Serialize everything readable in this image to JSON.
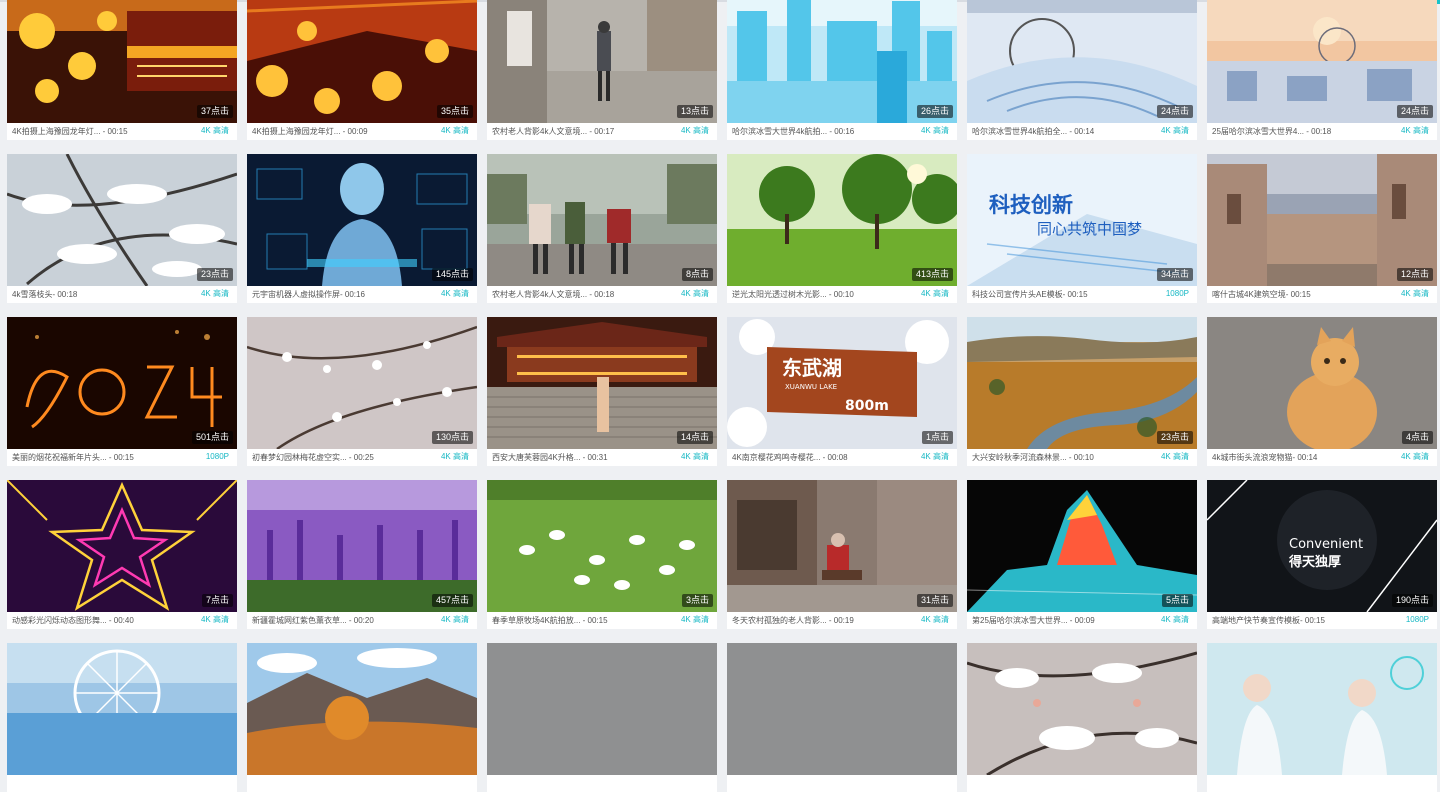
{
  "colors": {
    "accent": "#17c3c9",
    "quality_text": "#17b8c4",
    "page_bg": "#eef0f3"
  },
  "videos": [
    {
      "title": "4K拍摄上海豫园龙年灯...  - 00:15",
      "clicks": "37点击",
      "quality": "4K 高清",
      "thumb": "lantern-gold"
    },
    {
      "title": "4K拍摄上海豫园龙年灯...  - 00:09",
      "clicks": "35点击",
      "quality": "4K 高清",
      "thumb": "lantern-red"
    },
    {
      "title": "农村老人背影4k人文意境... - 00:17",
      "clicks": "13点击",
      "quality": "4K 高清",
      "thumb": "street-grey"
    },
    {
      "title": "哈尔滨冰雪大世界4k航拍... - 00:16",
      "clicks": "26点击",
      "quality": "4K 高清",
      "thumb": "ice-blue"
    },
    {
      "title": "哈尔滨冰雪世界4k航拍全... - 00:14",
      "clicks": "24点击",
      "quality": "4K 高清",
      "thumb": "ice-aerial"
    },
    {
      "title": "25届哈尔滨冰雪大世界4... - 00:18",
      "clicks": "24点击",
      "quality": "4K 高清",
      "thumb": "ice-sunset"
    },
    {
      "title": "4k雪落枝头- 00:18",
      "clicks": "23点击",
      "quality": "4K 高清",
      "thumb": "snow-branch"
    },
    {
      "title": "元宇宙机器人虚拟操作屏- 00:16",
      "clicks": "145点击",
      "quality": "4K 高清",
      "thumb": "robot"
    },
    {
      "title": "农村老人背影4k人文意境... - 00:18",
      "clicks": "8点击",
      "quality": "4K 高清",
      "thumb": "walk-park"
    },
    {
      "title": "逆光太阳光透过树木光影... - 00:10",
      "clicks": "413点击",
      "quality": "4K 高清",
      "thumb": "green-tree"
    },
    {
      "title": "科技公司宣传片头AE模板- 00:15",
      "clicks": "34点击",
      "quality": "1080P",
      "thumb": "tech-title"
    },
    {
      "title": "喀什古城4K建筑空境- 00:15",
      "clicks": "12点击",
      "quality": "4K 高清",
      "thumb": "old-city"
    },
    {
      "title": "美丽的烟花祝福新年片头... - 00:15",
      "clicks": "501点击",
      "quality": "1080P",
      "thumb": "fireworks"
    },
    {
      "title": "初春梦幻园林梅花虚空实... - 00:25",
      "clicks": "130点击",
      "quality": "4K 高清",
      "thumb": "plum-blossom"
    },
    {
      "title": "西安大唐芙蓉园4K升格... - 00:31",
      "clicks": "14点击",
      "quality": "4K 高清",
      "thumb": "tang-palace"
    },
    {
      "title": "4K南京樱花鸡鸣寺樱花... - 00:08",
      "clicks": "1点击",
      "quality": "4K 高清",
      "thumb": "sakura-sign"
    },
    {
      "title": "大兴安岭秋季河流森林景... - 00:10",
      "clicks": "23点击",
      "quality": "4K 高清",
      "thumb": "autumn-river"
    },
    {
      "title": "4k城市街头流浪宠物猫- 00:14",
      "clicks": "4点击",
      "quality": "4K 高清",
      "thumb": "cat"
    },
    {
      "title": "动感彩光闪烁动态图形舞... - 00:40",
      "clicks": "7点击",
      "quality": "4K 高清",
      "thumb": "neon-star"
    },
    {
      "title": "新疆霍城网红紫色薰衣草... - 00:20",
      "clicks": "457点击",
      "quality": "4K 高清",
      "thumb": "lavender"
    },
    {
      "title": "春季草原牧场4K航拍放... - 00:15",
      "clicks": "3点击",
      "quality": "4K 高清",
      "thumb": "sheep"
    },
    {
      "title": "冬天农村孤独的老人背影... - 00:19",
      "clicks": "31点击",
      "quality": "4K 高清",
      "thumb": "old-house"
    },
    {
      "title": "第25届哈尔滨冰雪大世界... - 00:09",
      "clicks": "5点击",
      "quality": "4K 高清",
      "thumb": "ice-sculpture"
    },
    {
      "title": "高端地产快节奏宣传模板- 00:15",
      "clicks": "190点击",
      "quality": "1080P",
      "thumb": "convenient"
    },
    {
      "title": "",
      "clicks": "",
      "quality": "",
      "thumb": "ferris-ice"
    },
    {
      "title": "",
      "clicks": "",
      "quality": "",
      "thumb": "mountain-autumn"
    },
    {
      "title": "",
      "clicks": "",
      "quality": "",
      "thumb": "grey"
    },
    {
      "title": "",
      "clicks": "",
      "quality": "",
      "thumb": "grey"
    },
    {
      "title": "",
      "clicks": "",
      "quality": "",
      "thumb": "snow-flowers"
    },
    {
      "title": "",
      "clicks": "",
      "quality": "",
      "thumb": "lab"
    }
  ],
  "overlay_text": {
    "tech_title": "科技创新 同心共筑中国梦",
    "sakura_sign": "东武湖",
    "sakura_sign_sub": "XUANWU LAKE",
    "sakura_sign_dist": "800m",
    "convenient_en": "Convenient",
    "convenient_cn": "得天独厚"
  }
}
